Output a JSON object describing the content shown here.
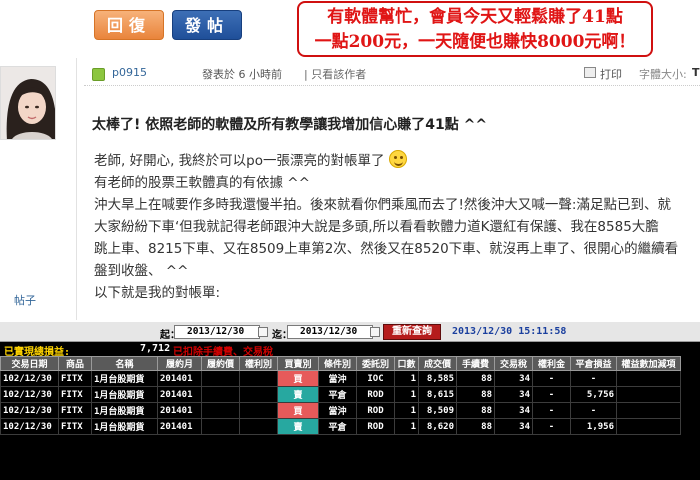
{
  "toolbar": {
    "reply_label": "回復",
    "post_label": "發帖"
  },
  "promo": {
    "line1": "有軟體幫忙，會員今天又輕鬆賺了41點",
    "line2": "一點200元，一天隨便也賺快8000元啊！"
  },
  "sidebar": {
    "link_label": "帖子"
  },
  "post_header": {
    "username": "p0915",
    "time": "發表於 6 小時前",
    "only_author": "| 只看該作者",
    "print": "打印",
    "font_size": "字體大小:",
    "font_small": "T",
    "font_large": "T"
  },
  "post": {
    "title": "太棒了! 依照老師的軟體及所有教學讓我增加信心賺了41點 ^^",
    "lines": [
      "老師, 好開心, 我終於可以po一張漂亮的對帳單了",
      "有老師的股票王軟體真的有依據  ^^",
      "沖大旱上在喊要作多時我還慢半拍。後來就看你們乘風而去了!然後沖大又喊一聲:滿足點已到、就",
      "大家紛紛下車‘但我就記得老師跟沖大說是多頭,所以看看軟體力道K還紅有保護、我在8585大膽",
      "跳上車、8215下車、又在8509上車第2次、然後又在8520下車、就沒再上車了、很開心的繼續看",
      "盤到收盤、 ^^",
      "以下就是我的對帳單:"
    ]
  },
  "trade": {
    "from_label": "起：",
    "from_date": "2013/12/30",
    "to_label": "迄：",
    "to_date": "2013/12/30",
    "query_button": "重新查詢",
    "timestamp": "2013/12/30 15:11:58",
    "realized_label": "已實現總損益:",
    "realized_value": "7,712",
    "fee_note": "已扣除手續費、交易稅",
    "columns": [
      "交易日期",
      "商品",
      "名稱",
      "履約月",
      "履約價",
      "權利別",
      "買賣別",
      "條件別",
      "委託別",
      "口數",
      "成交價",
      "手續費",
      "交易稅",
      "權利金",
      "平倉損益",
      "權益數加減項"
    ],
    "rows": [
      [
        "102/12/30",
        "FITX",
        "1月台股期貨",
        "201401",
        "",
        "",
        "買",
        "當沖",
        "IOC",
        "1",
        "8,585",
        "88",
        "34",
        "-",
        "-",
        ""
      ],
      [
        "102/12/30",
        "FITX",
        "1月台股期貨",
        "201401",
        "",
        "",
        "賣",
        "平倉",
        "ROD",
        "1",
        "8,615",
        "88",
        "34",
        "-",
        "5,756",
        ""
      ],
      [
        "102/12/30",
        "FITX",
        "1月台股期貨",
        "201401",
        "",
        "",
        "買",
        "當沖",
        "ROD",
        "1",
        "8,509",
        "88",
        "34",
        "-",
        "-",
        ""
      ],
      [
        "102/12/30",
        "FITX",
        "1月台股期貨",
        "201401",
        "",
        "",
        "賣",
        "平倉",
        "ROD",
        "1",
        "8,620",
        "88",
        "34",
        "-",
        "1,956",
        ""
      ]
    ]
  }
}
